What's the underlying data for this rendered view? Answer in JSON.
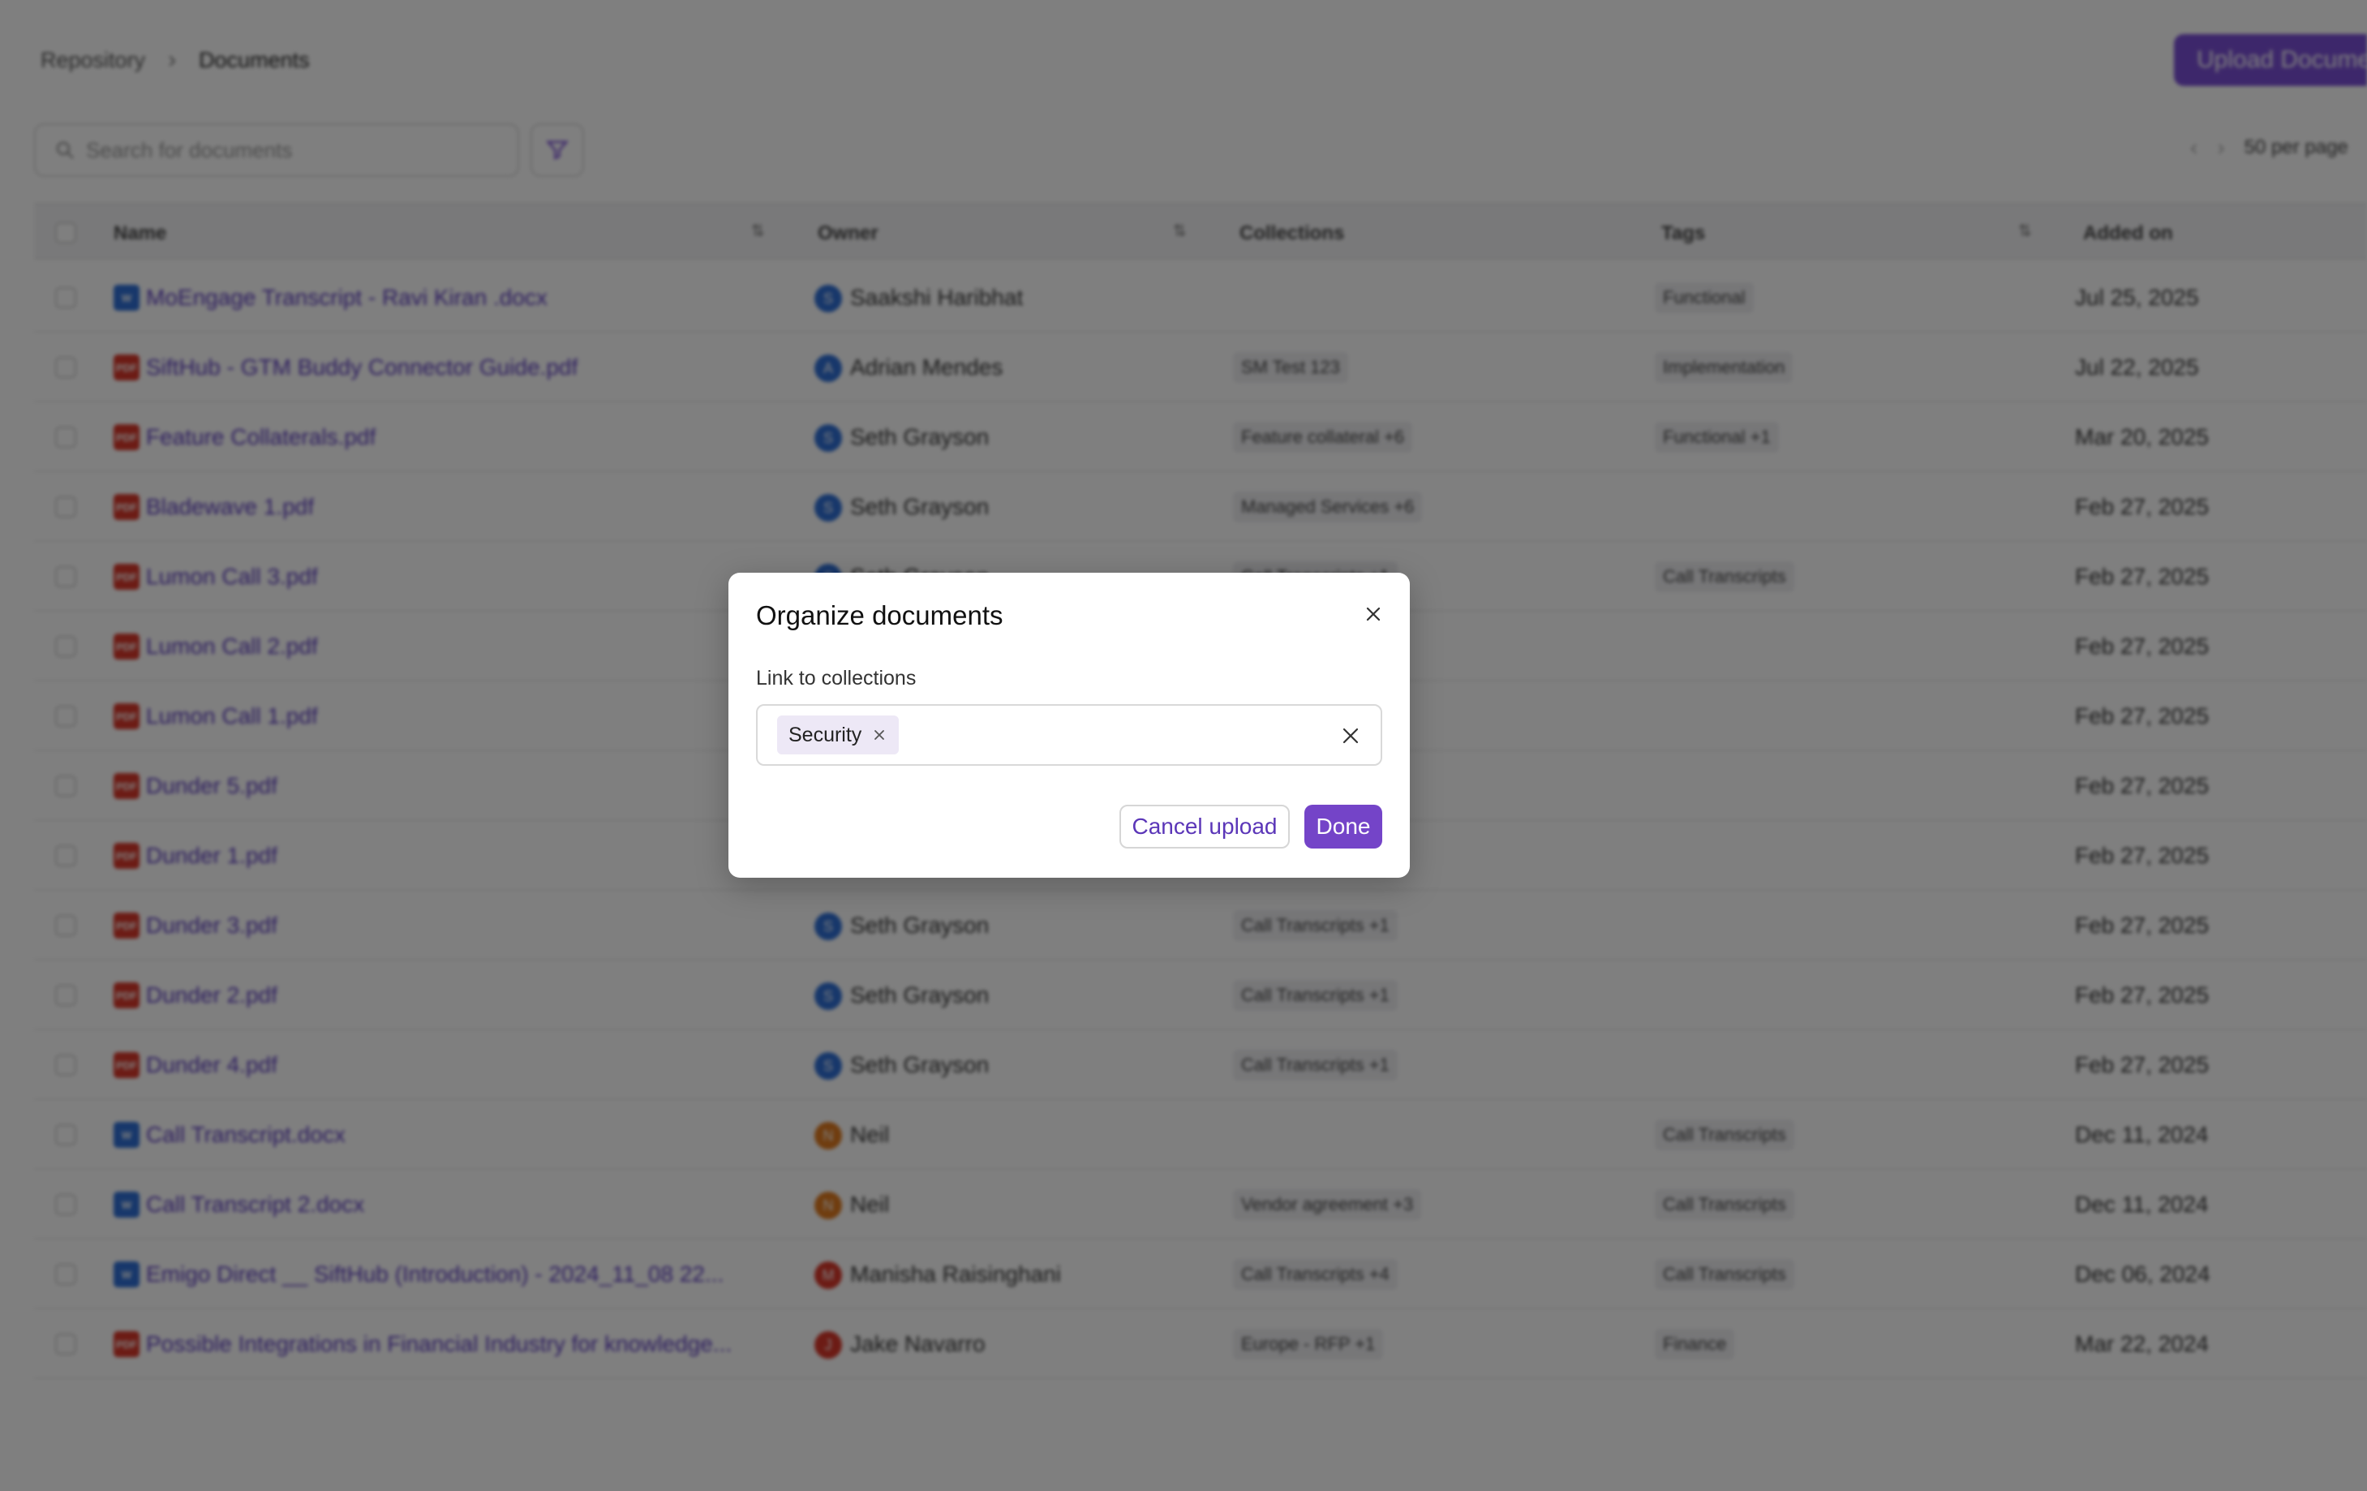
{
  "breadcrumb": {
    "root": "Repository",
    "separator": "›",
    "current": "Documents"
  },
  "header": {
    "upload_label": "Upload Documents"
  },
  "search": {
    "placeholder": "Search for documents"
  },
  "pager": {
    "prev": "‹",
    "next": "›",
    "per_page": "50 per page"
  },
  "table": {
    "columns": {
      "name": "Name",
      "owner": "Owner",
      "collections": "Collections",
      "tags": "Tags",
      "added_on": "Added on"
    },
    "sort_glyph": "⇅",
    "rows": [
      {
        "icon": "doc",
        "icon_label": "W",
        "name": "MoEngage Transcript - Ravi Kiran .docx",
        "avatar": "S",
        "avatar_color": "#2f6fd6",
        "owner": "Saakshi Haribhat",
        "collection": "",
        "tag": "Functional",
        "added": "Jul 25, 2025"
      },
      {
        "icon": "pdf",
        "icon_label": "PDF",
        "name": "SiftHub - GTM Buddy Connector Guide.pdf",
        "avatar": "A",
        "avatar_color": "#2f6fd6",
        "owner": "Adrian Mendes",
        "collection": "SM Test 123",
        "tag": "Implementation",
        "added": "Jul 22, 2025"
      },
      {
        "icon": "pdf",
        "icon_label": "PDF",
        "name": "Feature Collaterals.pdf",
        "avatar": "S",
        "avatar_color": "#2f6fd6",
        "owner": "Seth Grayson",
        "collection": "Feature collateral +6",
        "tag": "Functional +1",
        "added": "Mar 20, 2025"
      },
      {
        "icon": "pdf",
        "icon_label": "PDF",
        "name": "Bladewave 1.pdf",
        "avatar": "S",
        "avatar_color": "#2f6fd6",
        "owner": "Seth Grayson",
        "collection": "Managed Services +6",
        "tag": "",
        "added": "Feb 27, 2025"
      },
      {
        "icon": "pdf",
        "icon_label": "PDF",
        "name": "Lumon Call 3.pdf",
        "avatar": "S",
        "avatar_color": "#2f6fd6",
        "owner": "Seth Grayson",
        "collection": "Call Transcripts +1",
        "tag": "Call Transcripts",
        "added": "Feb 27, 2025"
      },
      {
        "icon": "pdf",
        "icon_label": "PDF",
        "name": "Lumon Call 2.pdf",
        "avatar": "",
        "avatar_color": "#2f6fd6",
        "owner": "",
        "collection": "",
        "tag": "",
        "added": "Feb 27, 2025"
      },
      {
        "icon": "pdf",
        "icon_label": "PDF",
        "name": "Lumon Call 1.pdf",
        "avatar": "",
        "avatar_color": "#2f6fd6",
        "owner": "",
        "collection": "",
        "tag": "",
        "added": "Feb 27, 2025"
      },
      {
        "icon": "pdf",
        "icon_label": "PDF",
        "name": "Dunder 5.pdf",
        "avatar": "",
        "avatar_color": "#2f6fd6",
        "owner": "",
        "collection": "",
        "tag": "",
        "added": "Feb 27, 2025"
      },
      {
        "icon": "pdf",
        "icon_label": "PDF",
        "name": "Dunder 1.pdf",
        "avatar": "",
        "avatar_color": "#2f6fd6",
        "owner": "",
        "collection": "",
        "tag": "",
        "added": "Feb 27, 2025"
      },
      {
        "icon": "pdf",
        "icon_label": "PDF",
        "name": "Dunder 3.pdf",
        "avatar": "S",
        "avatar_color": "#2f6fd6",
        "owner": "Seth Grayson",
        "collection": "Call Transcripts +1",
        "tag": "",
        "added": "Feb 27, 2025"
      },
      {
        "icon": "pdf",
        "icon_label": "PDF",
        "name": "Dunder 2.pdf",
        "avatar": "S",
        "avatar_color": "#2f6fd6",
        "owner": "Seth Grayson",
        "collection": "Call Transcripts +1",
        "tag": "",
        "added": "Feb 27, 2025"
      },
      {
        "icon": "pdf",
        "icon_label": "PDF",
        "name": "Dunder 4.pdf",
        "avatar": "S",
        "avatar_color": "#2f6fd6",
        "owner": "Seth Grayson",
        "collection": "Call Transcripts +1",
        "tag": "",
        "added": "Feb 27, 2025"
      },
      {
        "icon": "doc",
        "icon_label": "W",
        "name": "Call Transcript.docx",
        "avatar": "N",
        "avatar_color": "#e07a1f",
        "owner": "Neil",
        "collection": "",
        "tag": "Call Transcripts",
        "added": "Dec 11, 2024"
      },
      {
        "icon": "doc",
        "icon_label": "W",
        "name": "Call Transcript 2.docx",
        "avatar": "N",
        "avatar_color": "#e07a1f",
        "owner": "Neil",
        "collection": "Vendor agreement +3",
        "tag": "Call Transcripts",
        "added": "Dec 11, 2024"
      },
      {
        "icon": "doc",
        "icon_label": "W",
        "name": "Emigo Direct __ SiftHub (Introduction) - 2024_11_08 22...",
        "avatar": "M",
        "avatar_color": "#d9372a",
        "owner": "Manisha Raisinghani",
        "collection": "Call Transcripts +4",
        "tag": "Call Transcripts",
        "added": "Dec 06, 2024"
      },
      {
        "icon": "pdf",
        "icon_label": "PDF",
        "name": "Possible Integrations in Financial Industry for knowledge...",
        "avatar": "J",
        "avatar_color": "#d9372a",
        "owner": "Jake Navarro",
        "collection": "Europe - RFP +1",
        "tag": "Finance",
        "added": "Mar 22, 2024"
      }
    ]
  },
  "modal": {
    "title": "Organize documents",
    "field_label": "Link to collections",
    "selected_collections": [
      "Security"
    ],
    "cancel_label": "Cancel upload",
    "done_label": "Done"
  },
  "colors": {
    "accent": "#7444c8",
    "chip_bg": "#ede8f6",
    "pdf": "#d9372a",
    "doc": "#2f6fd6"
  }
}
